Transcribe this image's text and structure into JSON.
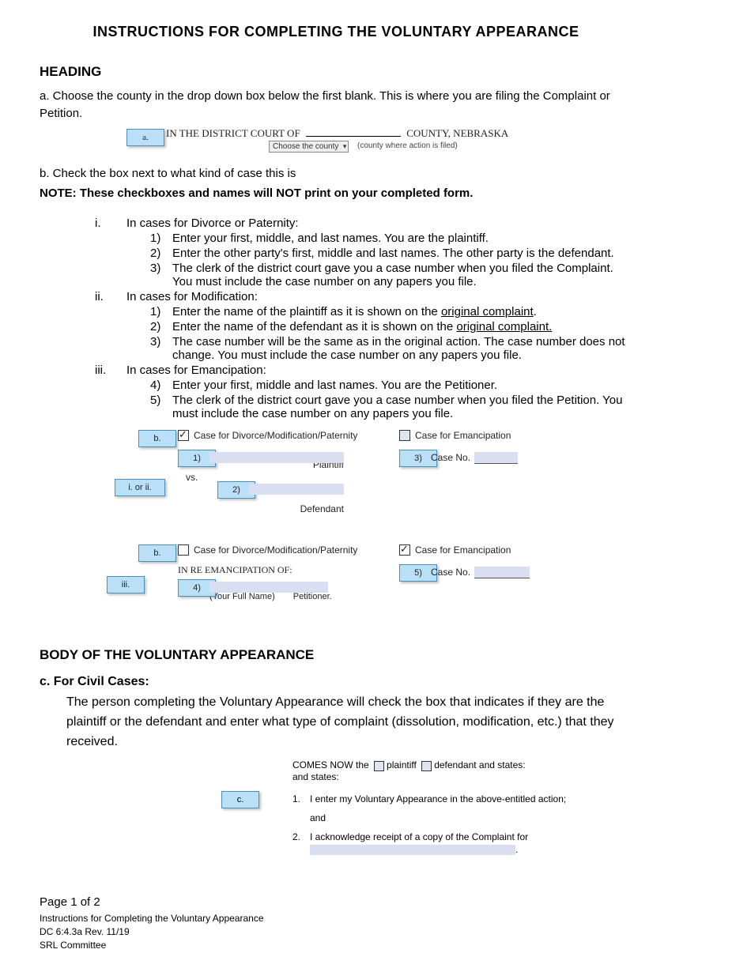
{
  "title": "INSTRUCTIONS FOR COMPLETING THE VOLUNTARY APPEARANCE",
  "heading_section": "HEADING",
  "a_text": "a.   Choose the county in the drop down box below the first blank. This is where you are filing the Complaint or Petition.",
  "fig1": {
    "tag": "a.",
    "prefix": "IN THE DISTRICT COURT OF",
    "suffix": "COUNTY, NEBRASKA",
    "dropdown": "Choose the county",
    "hint": "(county where action is filed)"
  },
  "b_text": "b.   Check the box next to what kind of case this is",
  "note": "NOTE: These checkboxes and names will NOT print on your completed form.",
  "roman": {
    "i_label": "i.",
    "i_text": "In cases for Divorce or Paternity:",
    "i_items": {
      "n1": "1)",
      "t1": "Enter your first, middle, and last names. You are the plaintiff.",
      "n2": "2)",
      "t2": "Enter the other party's first, middle and last names. The other party is the defendant.",
      "n3": "3)",
      "t3": "The clerk of the district court gave you a case number when you filed the Complaint. You must include the case number on any papers you file."
    },
    "ii_label": "ii.",
    "ii_text": "In cases for Modification:",
    "ii_items": {
      "n1": "1)",
      "t1a": "Enter the name of the plaintiff as it is shown on the ",
      "u1": "original complaint",
      "t1b": ".",
      "n2": "2)",
      "t2a": "Enter the name of the defendant as it is shown on the ",
      "u2": "original complaint.",
      "t2b": "",
      "n3": "3)",
      "t3": "The case number will be the same as in the original action. The case number does not change. You must include the case number on any papers you file."
    },
    "iii_label": "iii.",
    "iii_text": "In cases for Emancipation:",
    "iii_items": {
      "n4": "4)",
      "t4": "Enter your first, middle and last names. You are the Petitioner.",
      "n5": "5)",
      "t5": "The clerk of the district court gave you a case number when you filed the Petition. You must include the case number on any papers you file."
    }
  },
  "fig2": {
    "tag_b": "b.",
    "tag_side": "i. or ii.",
    "cb1_label": "Case for Divorce/Modification/Paternity",
    "cb2_label": "Case for Emancipation",
    "n1": "1)",
    "n2": "2)",
    "n3": "3)",
    "plaintiff": "Plaintiff",
    "vs": "vs.",
    "defendant": "Defendant",
    "caseno": "Case No."
  },
  "fig3": {
    "tag_b": "b.",
    "tag_side": "iii.",
    "cb1_label": "Case for Divorce/Modification/Paternity",
    "cb2_label": "Case for Emancipation",
    "inre": "IN RE EMANCIPATION OF:",
    "n4": "4)",
    "n5": "5)",
    "yourname": "(Your Full Name)",
    "petitioner": "Petitioner.",
    "caseno": "Case No."
  },
  "body_section": "BODY OF THE VOLUNTARY APPEARANCE",
  "c_heading": "c.  For Civil Cases:",
  "c_text": "The person completing the Voluntary Appearance will check the box that indicates if they are the plaintiff or the defendant and enter what type of complaint (dissolution, modification, etc.) that they received.",
  "figc": {
    "tag": "c.",
    "line1a": "COMES NOW the",
    "plaintiff": "plaintiff",
    "defendant": "defendant and states:",
    "line1b": "and states:",
    "n1": "1.",
    "t1": "I enter my Voluntary Appearance in the above-entitled action;",
    "and": "and",
    "n2": "2.",
    "t2": "I acknowledge receipt of a copy of the Complaint for"
  },
  "footer": {
    "page": "Page 1 of 2",
    "l1": "Instructions for Completing the Voluntary Appearance",
    "l2": "DC 6:4.3a Rev. 11/19",
    "l3": "SRL Committee"
  }
}
